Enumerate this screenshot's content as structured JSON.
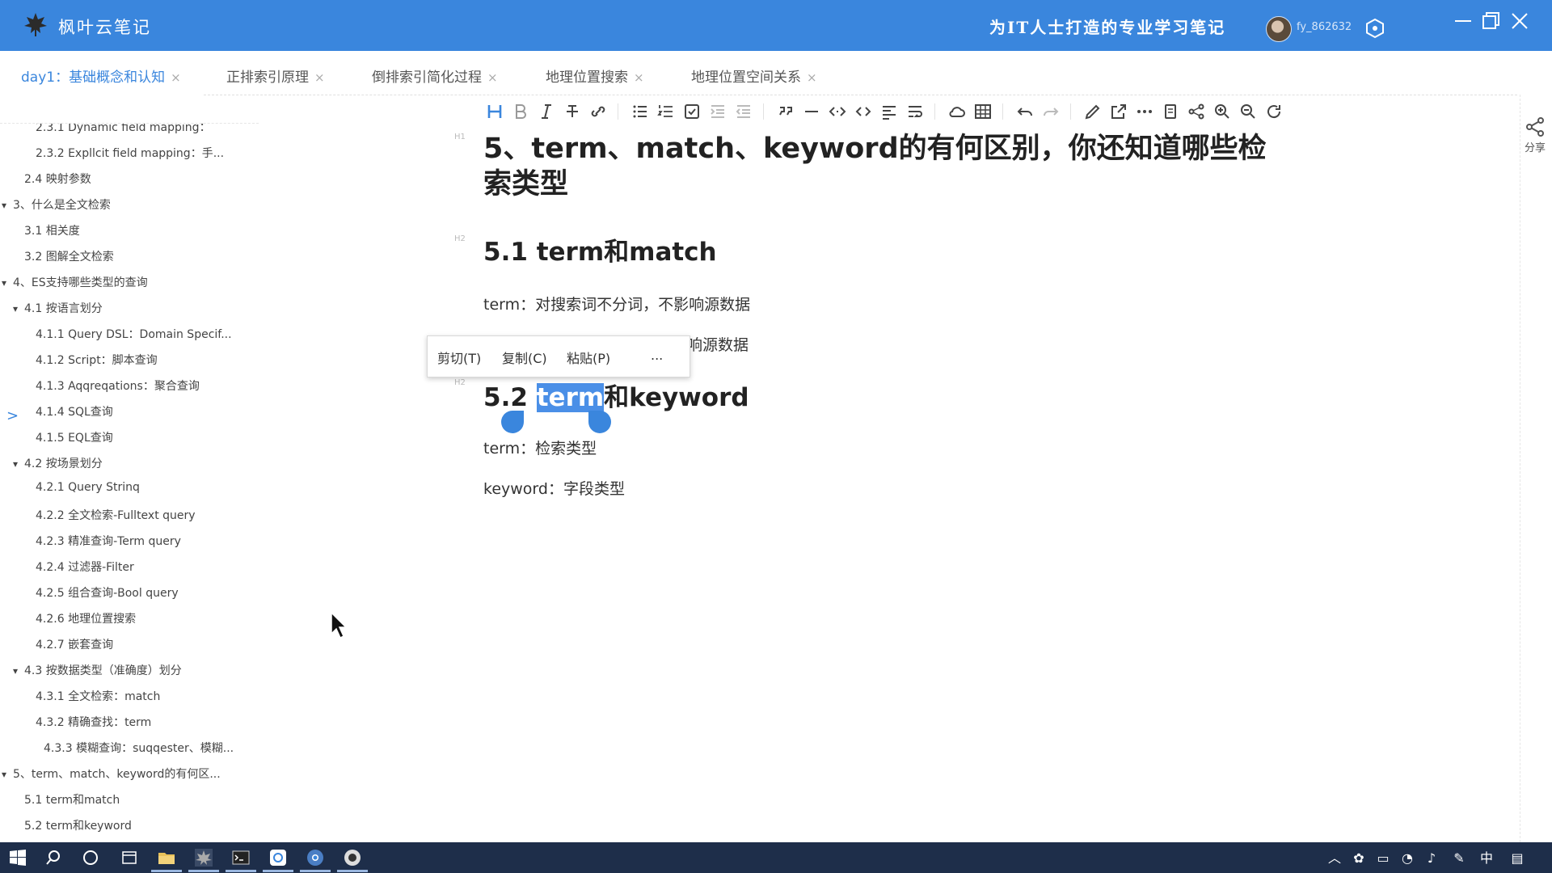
{
  "app": {
    "name": "枫叶云笔记",
    "slogan": "为IT人士打造的专业学习笔记",
    "username": "fy_862632"
  },
  "tabs": [
    {
      "label": "day1：基础概念和认知",
      "active": true
    },
    {
      "label": "正排索引原理",
      "active": false
    },
    {
      "label": "倒排索引简化过程",
      "active": false
    },
    {
      "label": "地理位置搜索",
      "active": false
    },
    {
      "label": "地理位置空间关系",
      "active": false
    }
  ],
  "tab_close_glyph": "×",
  "outline": [
    {
      "label": "2.3.1 Dynamic field mapping：",
      "level": 3
    },
    {
      "label": "2.3.2 Expllcit field mapping：手...",
      "level": 3
    },
    {
      "label": "2.4 映射参数",
      "level": 2
    },
    {
      "label": "3、什么是全文检索",
      "level": 1,
      "expanded": true
    },
    {
      "label": "3.1 相关度",
      "level": 2
    },
    {
      "label": "3.2 图解全文检索",
      "level": 2
    },
    {
      "label": "4、ES支持哪些类型的查询",
      "level": 1,
      "expanded": true
    },
    {
      "label": "4.1 按语言划分",
      "level": 2,
      "expanded": true
    },
    {
      "label": "4.1.1 Query DSL：Domain Specif...",
      "level": 3
    },
    {
      "label": "4.1.2 Script：脚本查询",
      "level": 3
    },
    {
      "label": "4.1.3 Aqqreqations：聚合查询",
      "level": 3
    },
    {
      "label": "4.1.4 SQL查询",
      "level": 3
    },
    {
      "label": "4.1.5 EQL查询",
      "level": 3
    },
    {
      "label": "4.2 按场景划分",
      "level": 2,
      "expanded": true
    },
    {
      "label": "4.2.1 Query Strinq",
      "level": 3
    },
    {
      "label": "4.2.2 全文检索-Fulltext query",
      "level": 3
    },
    {
      "label": "4.2.3 精准查询-Term query",
      "level": 3
    },
    {
      "label": "4.2.4 过滤器-Filter",
      "level": 3
    },
    {
      "label": "4.2.5 组合查询-Bool query",
      "level": 3
    },
    {
      "label": "4.2.6 地理位置搜索",
      "level": 3
    },
    {
      "label": "4.2.7 嵌套查询",
      "level": 3
    },
    {
      "label": "4.3 按数据类型（准确度）划分",
      "level": 2,
      "expanded": true
    },
    {
      "label": "4.3.1 全文检索：match",
      "level": 3
    },
    {
      "label": "4.3.2 精确查找：term",
      "level": 3
    },
    {
      "label": "4.3.3 模糊查询：suqqester、模糊...",
      "level": 3
    },
    {
      "label": "5、term、match、keyword的有何区...",
      "level": 1,
      "expanded": true
    },
    {
      "label": "5.1 term和match",
      "level": 2
    },
    {
      "label": "5.2 term和keyword",
      "level": 2
    }
  ],
  "editor": {
    "h1_mark": "H1",
    "h2_mark": "H2",
    "h1": "5、term、match、keyword的有何区别，你还知道哪些检索类型",
    "h2_1": "5.1 term和match",
    "p1": "term：对搜索词不分词，不影响源数据",
    "p2_visible": "响源数据",
    "h2_2_prefix": "5.2 ",
    "h2_2_selected": "term",
    "h2_2_suffix": "和keyword",
    "p3": "term：检索类型",
    "p4": "keyword：字段类型"
  },
  "context_menu": {
    "cut": "剪切(T)",
    "copy": "复制(C)",
    "paste": "粘贴(P)",
    "more": "..."
  },
  "share_label": "分享",
  "colors": {
    "brand": "#3a86dd",
    "selection": "#4a8fe7",
    "taskbar": "#1e2e4a"
  },
  "toolbar_icons": [
    "heading-icon",
    "bold-icon",
    "italic-icon",
    "strikethrough-icon",
    "link-icon",
    "bullet-list-icon",
    "ordered-list-icon",
    "task-list-icon",
    "indent-icon",
    "outdent-icon",
    "quote-icon",
    "hr-icon",
    "inline-code-icon",
    "code-block-icon",
    "align-icon",
    "wrap-icon",
    "cloud-icon",
    "table-icon",
    "undo-icon",
    "redo-icon",
    "edit-icon",
    "external-icon",
    "more-icon",
    "export-icon",
    "mindmap-icon",
    "zoom-in-icon",
    "zoom-out-icon",
    "refresh-icon"
  ],
  "tray": {
    "ime": "中"
  }
}
